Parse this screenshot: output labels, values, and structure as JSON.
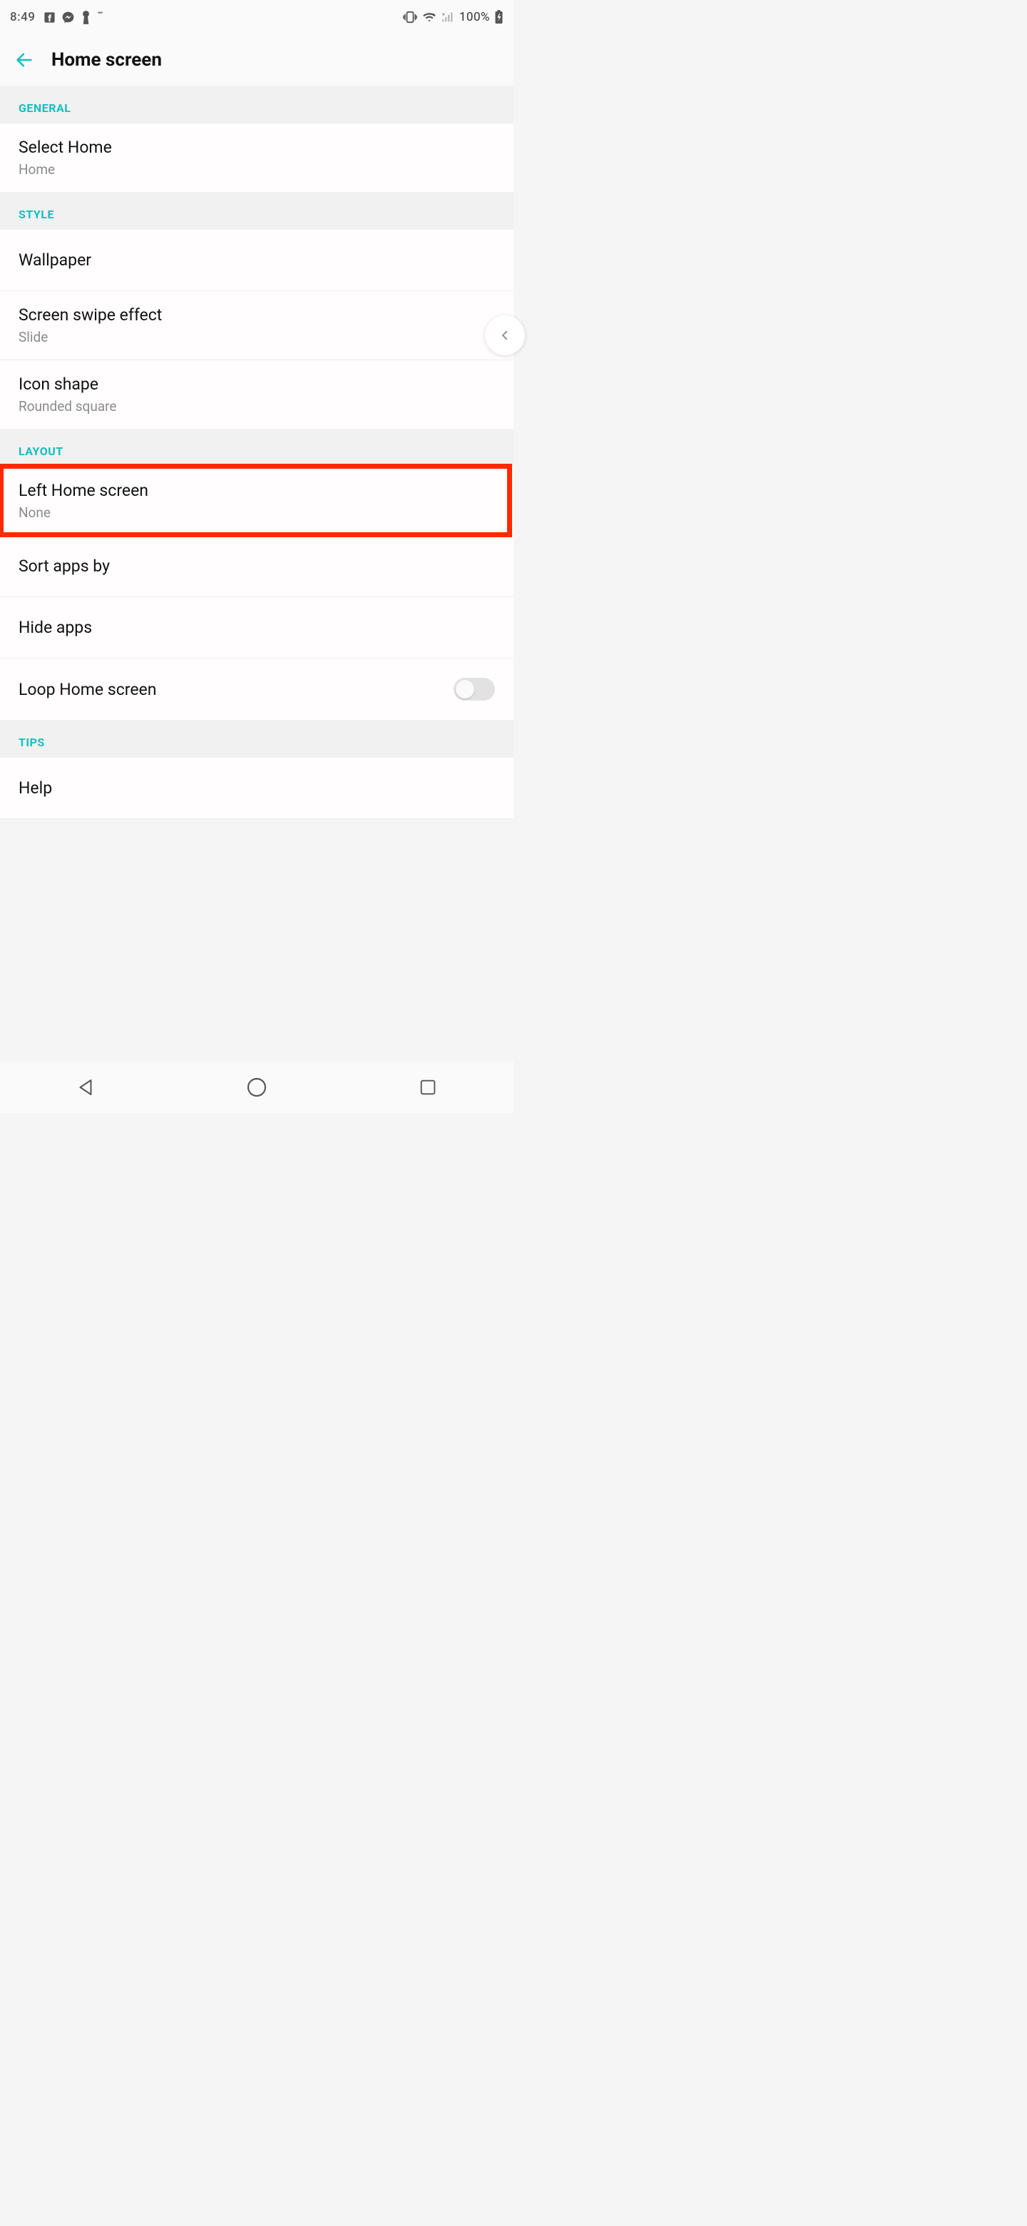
{
  "status": {
    "time": "8:49",
    "battery_pct": "100%"
  },
  "appbar": {
    "title": "Home screen"
  },
  "sections": {
    "general": {
      "label": "GENERAL",
      "select_home": {
        "title": "Select Home",
        "sub": "Home"
      }
    },
    "style": {
      "label": "STYLE",
      "wallpaper": {
        "title": "Wallpaper"
      },
      "swipe": {
        "title": "Screen swipe effect",
        "sub": "Slide"
      },
      "icon": {
        "title": "Icon shape",
        "sub": "Rounded square"
      }
    },
    "layout": {
      "label": "LAYOUT",
      "left_home": {
        "title": "Left Home screen",
        "sub": "None"
      },
      "sort": {
        "title": "Sort apps by"
      },
      "hide": {
        "title": "Hide apps"
      },
      "loop": {
        "title": "Loop Home screen"
      }
    },
    "tips": {
      "label": "TIPS",
      "help": {
        "title": "Help"
      }
    }
  }
}
